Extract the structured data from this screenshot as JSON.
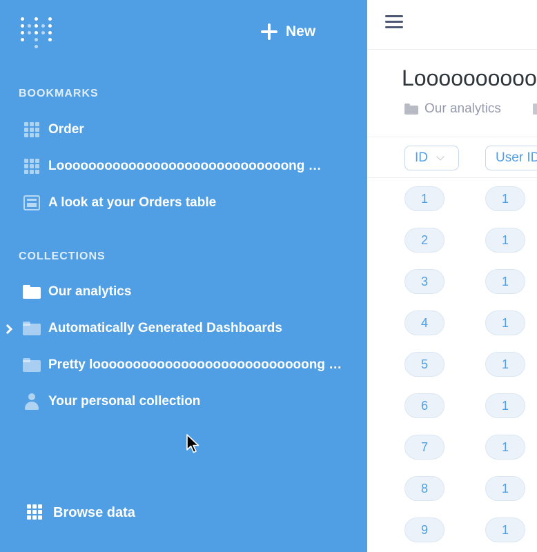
{
  "sidebar": {
    "new_label": "New",
    "bookmarks_title": "BOOKMARKS",
    "bookmarks": [
      {
        "label": "Order",
        "icon": "table-grid-icon"
      },
      {
        "label": "Looooooooooooooooooooooooooooong …",
        "icon": "table-grid-icon"
      },
      {
        "label": "A look at your Orders table",
        "icon": "dashboard-icon"
      }
    ],
    "collections_title": "COLLECTIONS",
    "collections": [
      {
        "label": "Our analytics",
        "icon": "folder-icon"
      },
      {
        "label": "Automatically Generated Dashboards",
        "icon": "folder-icon",
        "expandable": true
      },
      {
        "label": "Pretty looooooooooooooooooooooooooong …",
        "icon": "folder-icon"
      },
      {
        "label": "Your personal collection",
        "icon": "person-icon"
      }
    ],
    "browse_label": "Browse data"
  },
  "main": {
    "title": "Loooooooooooo",
    "breadcrumb": "Our analytics",
    "columns": [
      "ID",
      "User ID"
    ],
    "rows": [
      [
        "1",
        "1"
      ],
      [
        "2",
        "1"
      ],
      [
        "3",
        "1"
      ],
      [
        "4",
        "1"
      ],
      [
        "5",
        "1"
      ],
      [
        "6",
        "1"
      ],
      [
        "7",
        "1"
      ],
      [
        "8",
        "1"
      ],
      [
        "9",
        "1"
      ]
    ]
  },
  "colors": {
    "sidebar_bg": "#509ee3",
    "accent": "#509ee3",
    "text_dark": "#2e353b",
    "text_muted": "#949aab"
  }
}
